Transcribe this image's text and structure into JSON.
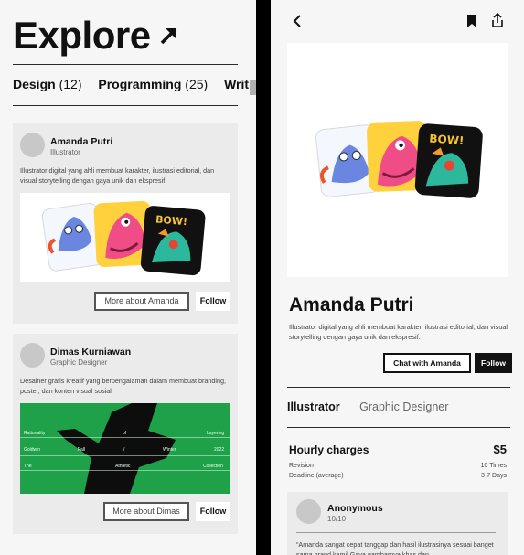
{
  "explore": {
    "title": "Explore",
    "tabs": [
      {
        "label": "Design",
        "count": "(12)"
      },
      {
        "label": "Programming",
        "count": "(25)"
      },
      {
        "label": "Writing",
        "count": ""
      }
    ]
  },
  "cards": [
    {
      "name": "Amanda Putri",
      "role": "Illustrator",
      "bio": "Illustrator digital yang ahli membuat karakter, ilustrasi editorial, dan visual storytelling dengan gaya unik dan ekspresif.",
      "more_label": "More about Amanda",
      "follow_label": "Follow"
    },
    {
      "name": "Dimas Kurniawan",
      "role": "Graphic Designer",
      "bio": "Desainer grafis kreatif yang berpengalaman dalam membuat branding, poster, dan konten visual sosial",
      "more_label": "More about Dimas",
      "follow_label": "Follow",
      "poster": {
        "row1": [
          "Rationality",
          "of",
          "Layering"
        ],
        "row2": [
          "Goldwin",
          "Fall",
          "/",
          "Winter",
          "2022"
        ],
        "row3": [
          "The",
          "Athletic",
          "Collection"
        ]
      }
    }
  ],
  "profile": {
    "name": "Amanda Putri",
    "bio": "Illustrator digital yang ahli membuat karakter, ilustrasi editorial, dan visual storytelling dengan gaya unik dan ekspresif.",
    "chat_label": "Chat with Amanda",
    "follow_label": "Follow",
    "tabs": [
      "Illustrator",
      "Graphic Designer"
    ],
    "charges": {
      "label": "Hourly charges",
      "price": "$5",
      "rows": [
        {
          "label": "Revision",
          "value": "10 Times"
        },
        {
          "label": "Deadline (average)",
          "value": "3-7 Days"
        }
      ]
    },
    "review": {
      "author": "Anonymous",
      "rating": "10/10",
      "text": "“Amanda sangat cepat tanggap dan hasil ilustrasinya sesuai banget sama brand kamil Gaya gambarnya khas dan"
    }
  },
  "colors": {
    "accent_green": "#1fa14a",
    "panel_bg": "#f6f6f6",
    "card_bg": "#ebebeb"
  },
  "icons": [
    "arrow-up-right-icon",
    "chevron-left-icon",
    "bookmark-icon",
    "share-icon"
  ]
}
